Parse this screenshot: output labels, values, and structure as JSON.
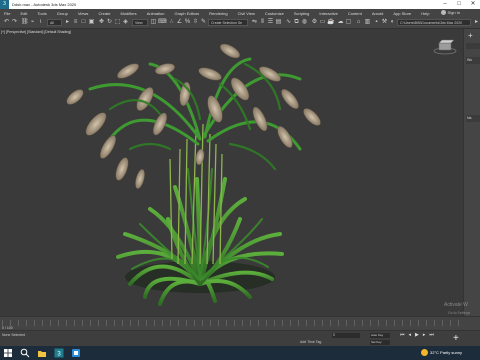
{
  "window": {
    "title": "Ddsh.max - Autodesk 3ds Max 2020",
    "controls": [
      "–",
      "□",
      "✕"
    ]
  },
  "menu": {
    "items": [
      "File",
      "Edit",
      "Tools",
      "Group",
      "Views",
      "Create",
      "Modifiers",
      "Animation",
      "Graph Editors",
      "Rendering",
      "Civil View",
      "Customize",
      "Scripting",
      "Interactive",
      "Content",
      "Arnold",
      "App Store",
      "Help"
    ],
    "signin": "Sign In",
    "workspace_label": "Workspaces:"
  },
  "toolbar": {
    "filter_select": "All",
    "view_select": "View",
    "selection_set": "Create Selection Se",
    "project_path": "C:\\Users\\BIN\\Documents\\3ds Max 2020"
  },
  "viewport": {
    "label": "[+] [Perspective] [Standard] [Default Shading]"
  },
  "command_panel": {
    "rollout_1": "Wo",
    "rollout_2": "Na"
  },
  "timeline": {
    "frame_counter": "0 / 100"
  },
  "status": {
    "selection": "None Selected",
    "add_time_tag": "Add Time Tag",
    "frame_value": "0",
    "auto_key": "Auto Key",
    "set_key": "Set Key",
    "watermark_title": "Activate W",
    "watermark_sub": "Go to Settings"
  },
  "taskbar": {
    "weather": "32°C  Partly sunny",
    "colors": {
      "bg": "#1c2c3a",
      "sun": "#f3b52b"
    }
  },
  "colors": {
    "viewport_bg": "#3a3a3a",
    "leaf_green": "#4f9a38",
    "flower_beige": "#b8a58e"
  }
}
